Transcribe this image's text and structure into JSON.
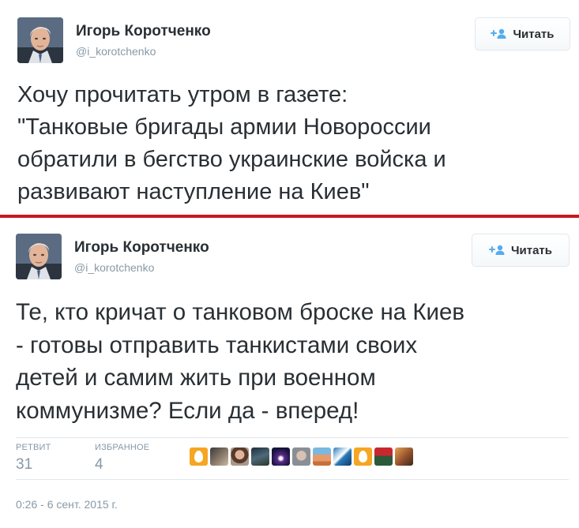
{
  "tweets": [
    {
      "author_name": "Игорь Коротченко",
      "author_handle": "@i_korotchenko",
      "follow_label": "Читать",
      "text": "Хочу прочитать утром в газете:\n\"Танковые бригады армии Новороссии\nобратили в бегство украинские войска и\nразвивают наступление на Киев\""
    },
    {
      "author_name": "Игорь Коротченко",
      "author_handle": "@i_korotchenko",
      "follow_label": "Читать",
      "text": "Те, кто кричат о танковом броске на Киев\n- готовы отправить танкистами своих\nдетей и самим жить при военном\nкоммунизме? Если да - вперед!",
      "stats": {
        "retweets_label": "РЕТВИТ",
        "retweets_count": "31",
        "favorites_label": "ИЗБРАННОЕ",
        "favorites_count": "4"
      },
      "timestamp": "0:26 - 6 сент. 2015 г."
    }
  ],
  "colors": {
    "divider": "#c9171b",
    "egg_avatar": "#f5a623",
    "muted_text": "#8899a6",
    "follow_icon": "#55acee"
  },
  "icons": {
    "follow": "add-person-icon",
    "default_avatar": "egg-icon"
  }
}
